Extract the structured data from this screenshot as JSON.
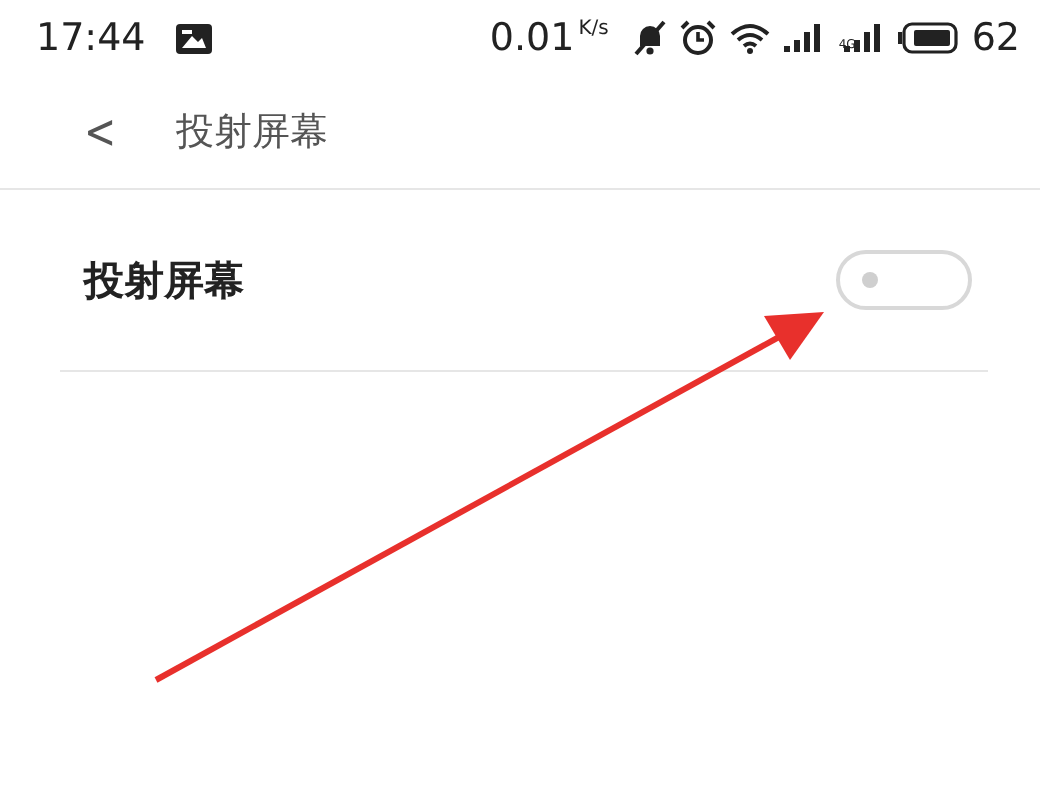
{
  "status_bar": {
    "time": "17:44",
    "speed": "0.01",
    "speed_unit": "K/s",
    "network_type": "4G",
    "battery": "62"
  },
  "header": {
    "back": "<",
    "title": "投射屏幕"
  },
  "settings": [
    {
      "kind": "switch",
      "label": "投射屏幕",
      "on": false
    }
  ]
}
